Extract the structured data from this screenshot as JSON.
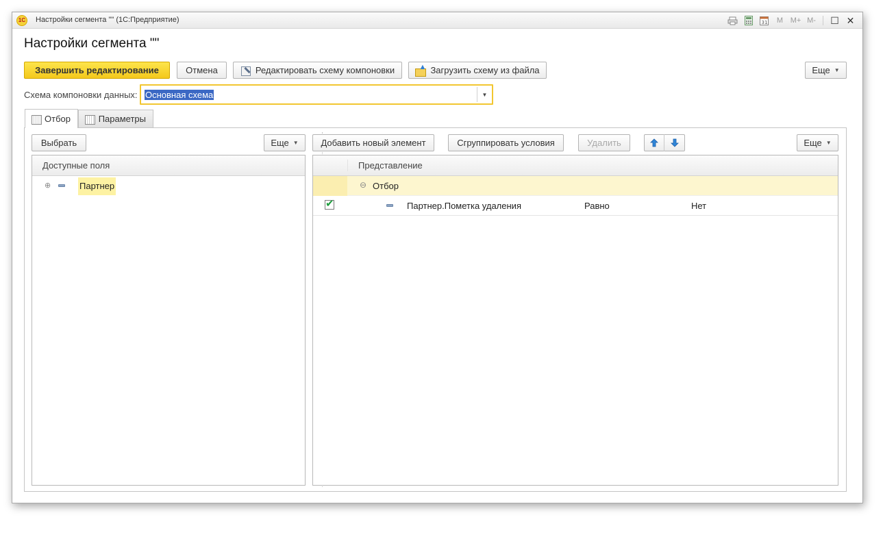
{
  "window": {
    "title": "Настройки сегмента \"\"  (1С:Предприятие)",
    "logo_text": "1С",
    "toolbar_icons": [
      "print-icon",
      "calculator-icon",
      "calendar-icon",
      "memory-m-icon",
      "memory-plus-icon",
      "memory-minus-icon",
      "maximize-icon",
      "close-icon"
    ],
    "memory_labels": {
      "m": "M",
      "mplus": "M+",
      "mminus": "M-"
    }
  },
  "form": {
    "title": "Настройки сегмента \"\"",
    "buttons": {
      "finish": "Завершить редактирование",
      "cancel": "Отмена",
      "edit_schema": "Редактировать схему компоновки",
      "load_schema": "Загрузить схему из файла",
      "more": "Еще"
    },
    "schema_field": {
      "label": "Схема компоновки данных:",
      "value": "Основная схема"
    }
  },
  "tabs": [
    {
      "label": "Отбор",
      "active": true
    },
    {
      "label": "Параметры",
      "active": false
    }
  ],
  "left_panel": {
    "buttons": {
      "select": "Выбрать",
      "more": "Еще"
    },
    "header": "Доступные поля",
    "items": [
      {
        "label": "Партнер"
      }
    ]
  },
  "right_panel": {
    "buttons": {
      "add": "Добавить новый элемент",
      "group": "Сгруппировать условия",
      "delete": "Удалить",
      "more": "Еще"
    },
    "header": "Представление",
    "group_row": {
      "label": "Отбор"
    },
    "conditions": [
      {
        "checked": true,
        "field": "Партнер.Пометка удаления",
        "comparison": "Равно",
        "value": "Нет"
      }
    ]
  },
  "colors": {
    "accent_yellow": "#f4c81c",
    "highlight_row": "#fdf6cf",
    "selection_blue": "#3b68c4",
    "check_green": "#1c9c3c"
  }
}
